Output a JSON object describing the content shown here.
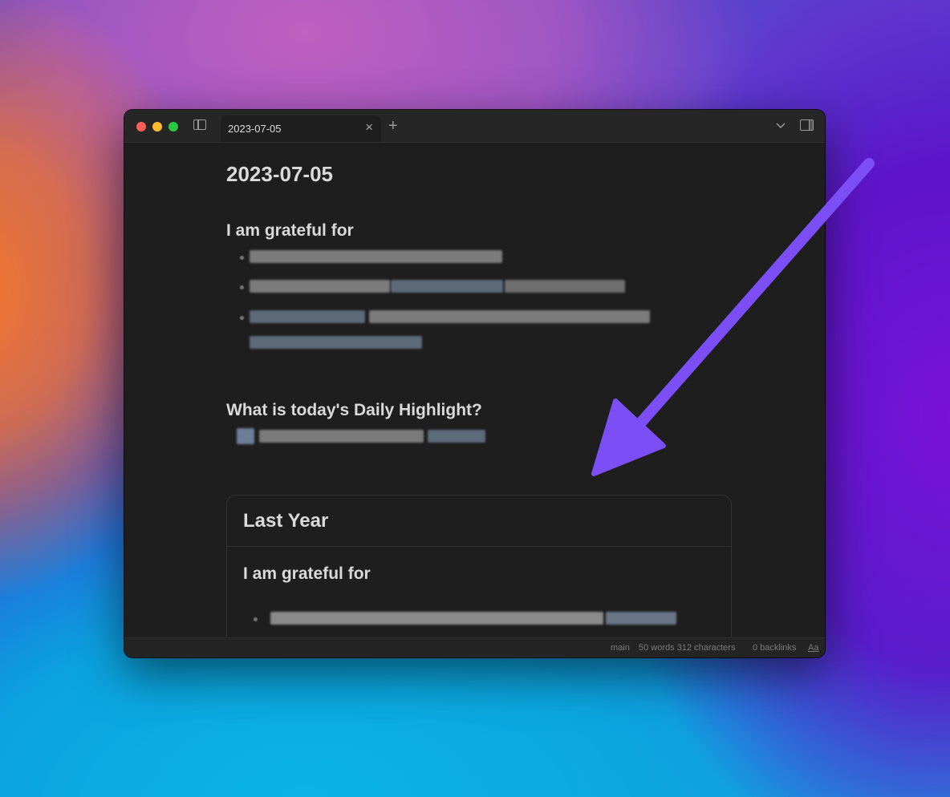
{
  "window": {
    "tab_title": "2023-07-05",
    "tab_close": "×",
    "new_tab": "+"
  },
  "note": {
    "title": "2023-07-05",
    "section1_heading": "I am grateful for",
    "section2_heading": "What is today's Daily Highlight?",
    "embed": {
      "title": "Last Year",
      "heading": "I am grateful for"
    }
  },
  "status_bar": {
    "branch": "main",
    "word_count": "50 words 312 characters",
    "backlinks": "0 backlinks",
    "font_toggle": "Aa"
  },
  "colors": {
    "accent_arrow": "#7b4ff5",
    "editor_bg": "#1e1e1e",
    "text": "#dadada"
  },
  "icons": [
    "sidebar-toggle-icon",
    "close-icon",
    "plus-icon",
    "chevron-down-icon",
    "right-sidebar-icon",
    "arrow-annotation"
  ]
}
